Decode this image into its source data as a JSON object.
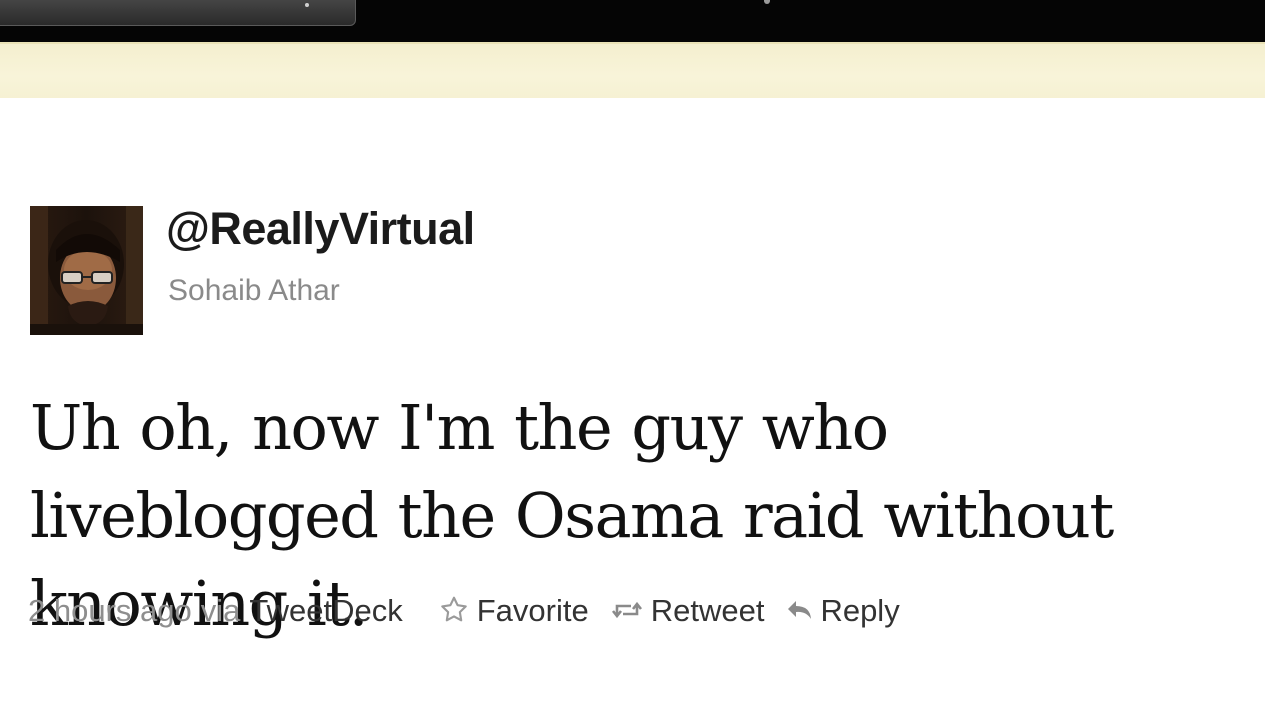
{
  "tweet": {
    "handle": "@ReallyVirtual",
    "name": "Sohaib Athar",
    "text": "Uh oh, now I'm the guy who liveblogged the Osama raid without knowing it.",
    "timestamp": "2 hours ago",
    "via_prefix": "via",
    "source": "TweetDeck"
  },
  "actions": {
    "favorite": "Favorite",
    "retweet": "Retweet",
    "reply": "Reply"
  },
  "colors": {
    "topbar": "#050505",
    "notice": "#f7f2d6",
    "handle": "#1b1b1b",
    "name": "#8a8a8a",
    "meta": "#8e8e8e"
  },
  "icons": {
    "favorite": "star-icon",
    "retweet": "retweet-icon",
    "reply": "reply-icon"
  }
}
